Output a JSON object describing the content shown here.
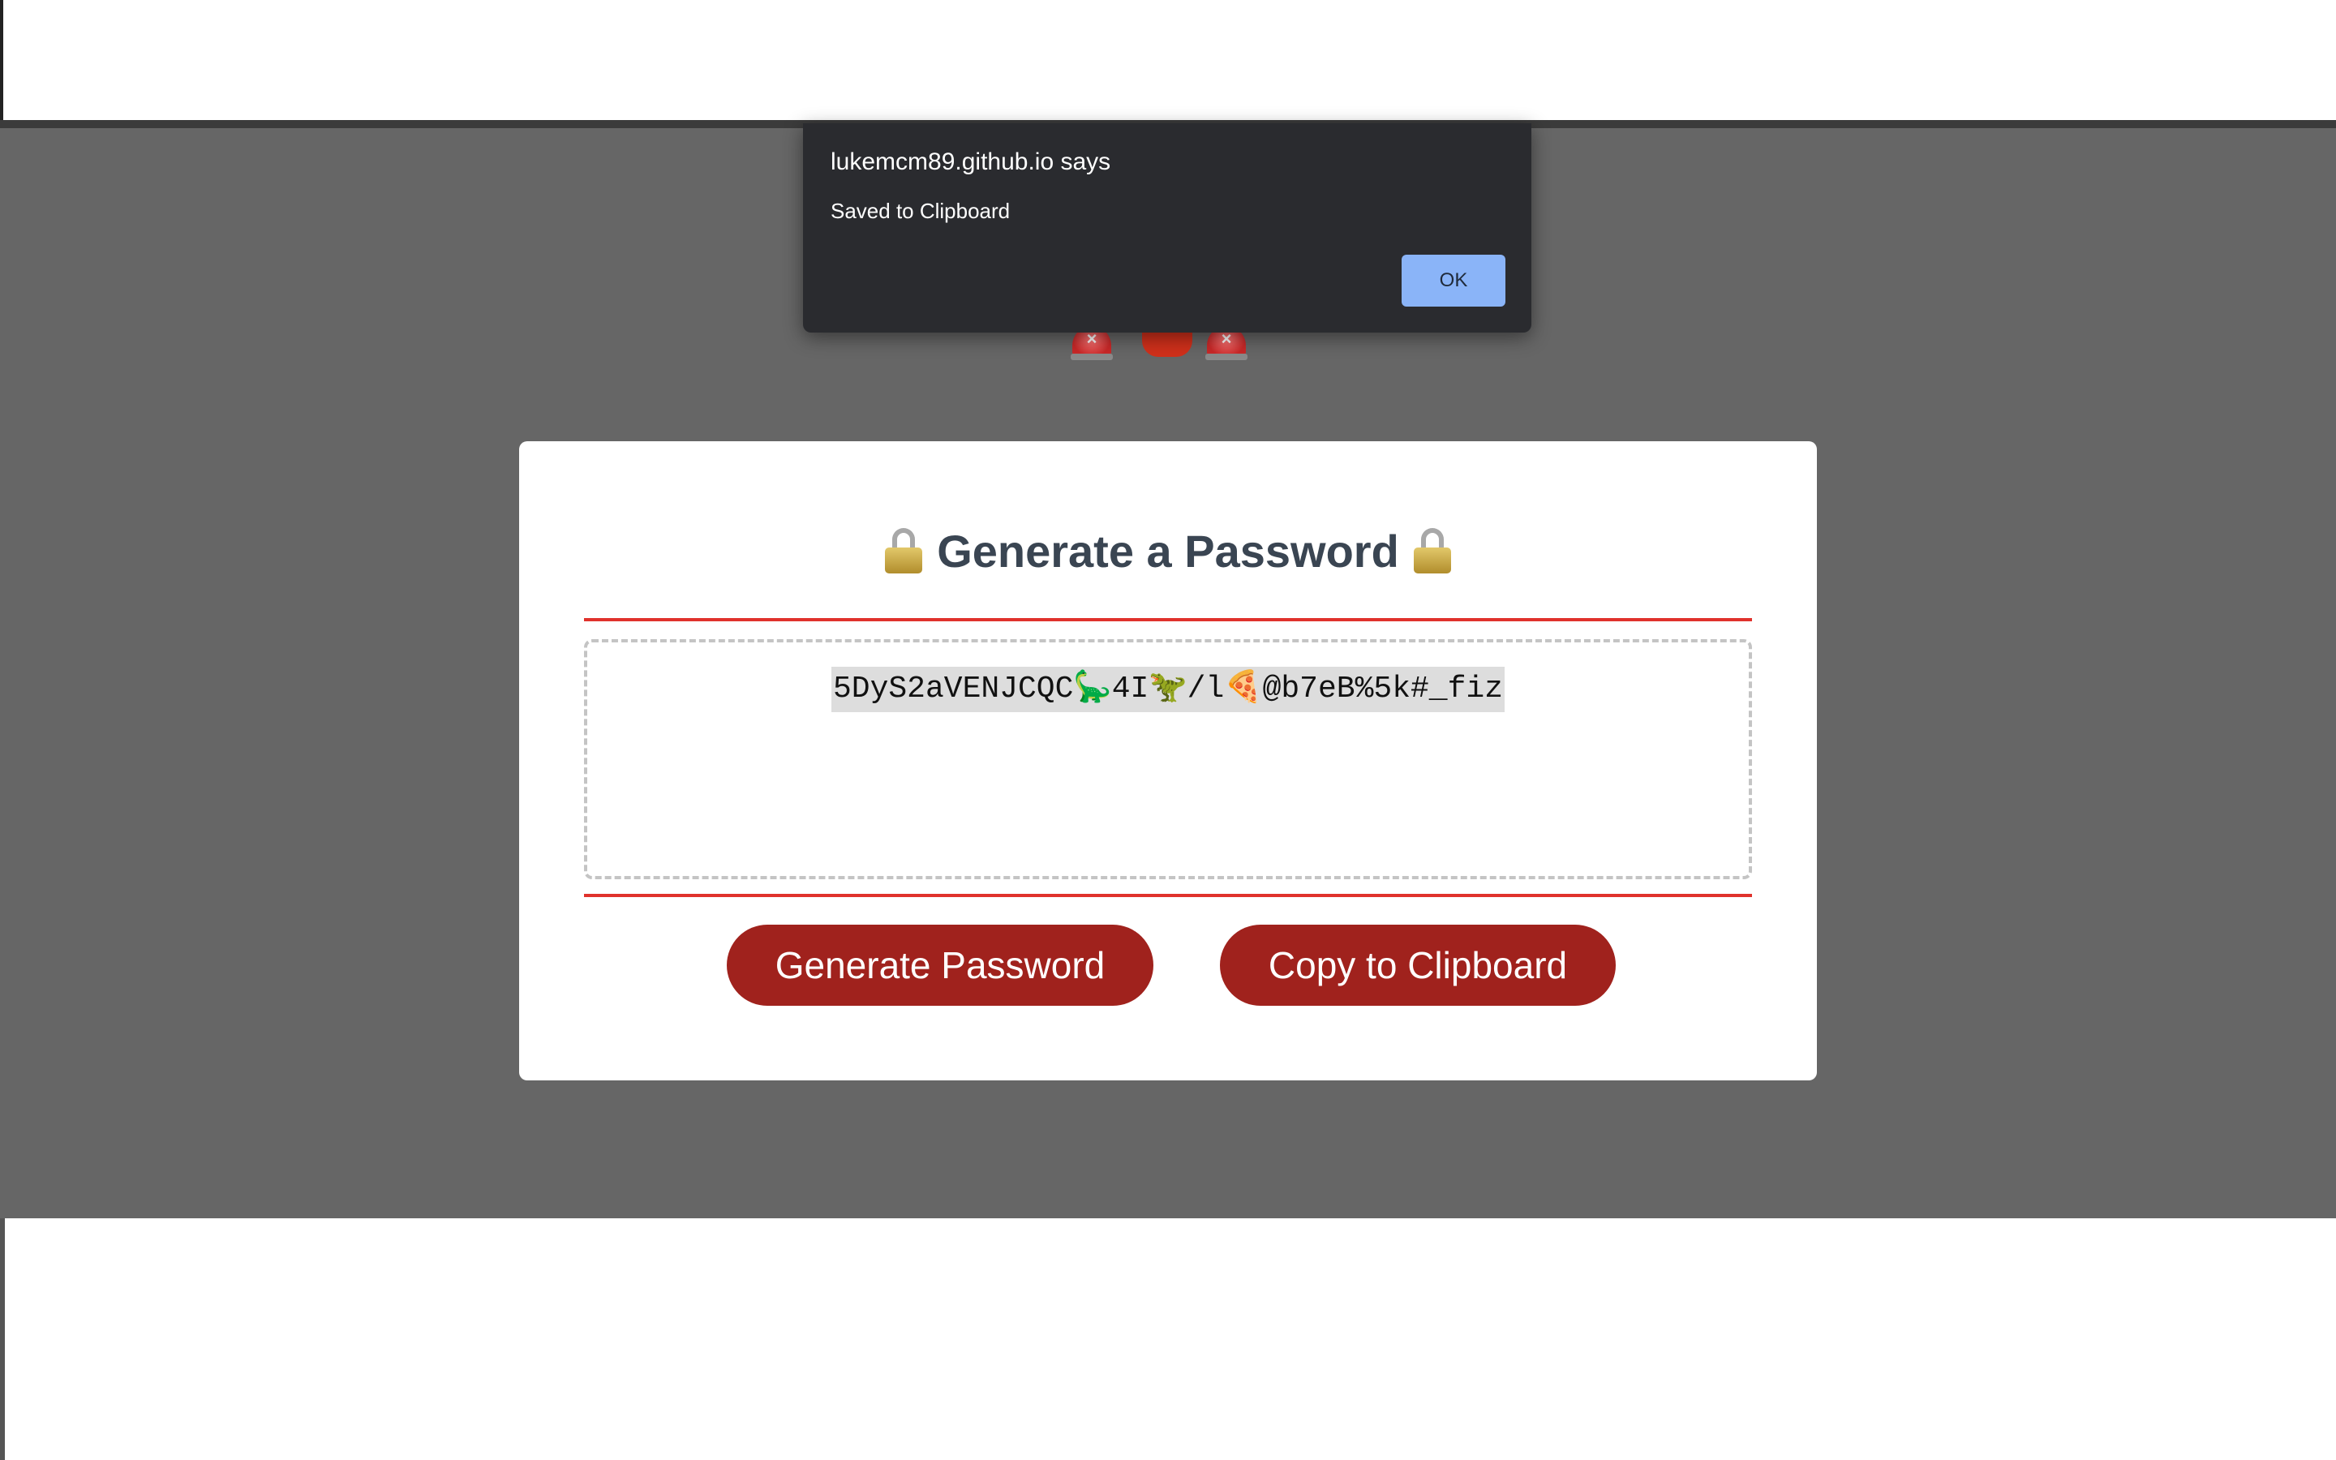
{
  "alert": {
    "title": "lukemcm89.github.io says",
    "message": "Saved to Clipboard",
    "ok_label": "OK"
  },
  "card": {
    "title": "Generate a Password",
    "title_icon": "lock-icon",
    "password": "5DyS2aVENJCQC🦕4I🦖/l🍕@b7eB%5k#_fiz",
    "generate_label": "Generate Password",
    "copy_label": "Copy to Clipboard"
  },
  "header": {
    "icons": [
      "siren-icon",
      "stop-sign-icon",
      "siren-icon"
    ]
  },
  "colors": {
    "overlay": "#666666",
    "button": "#a0221d",
    "rule": "#e0322c",
    "alert_bg": "#2a2b2f",
    "alert_button": "#8ab4f8",
    "title_text": "#3a4552"
  }
}
